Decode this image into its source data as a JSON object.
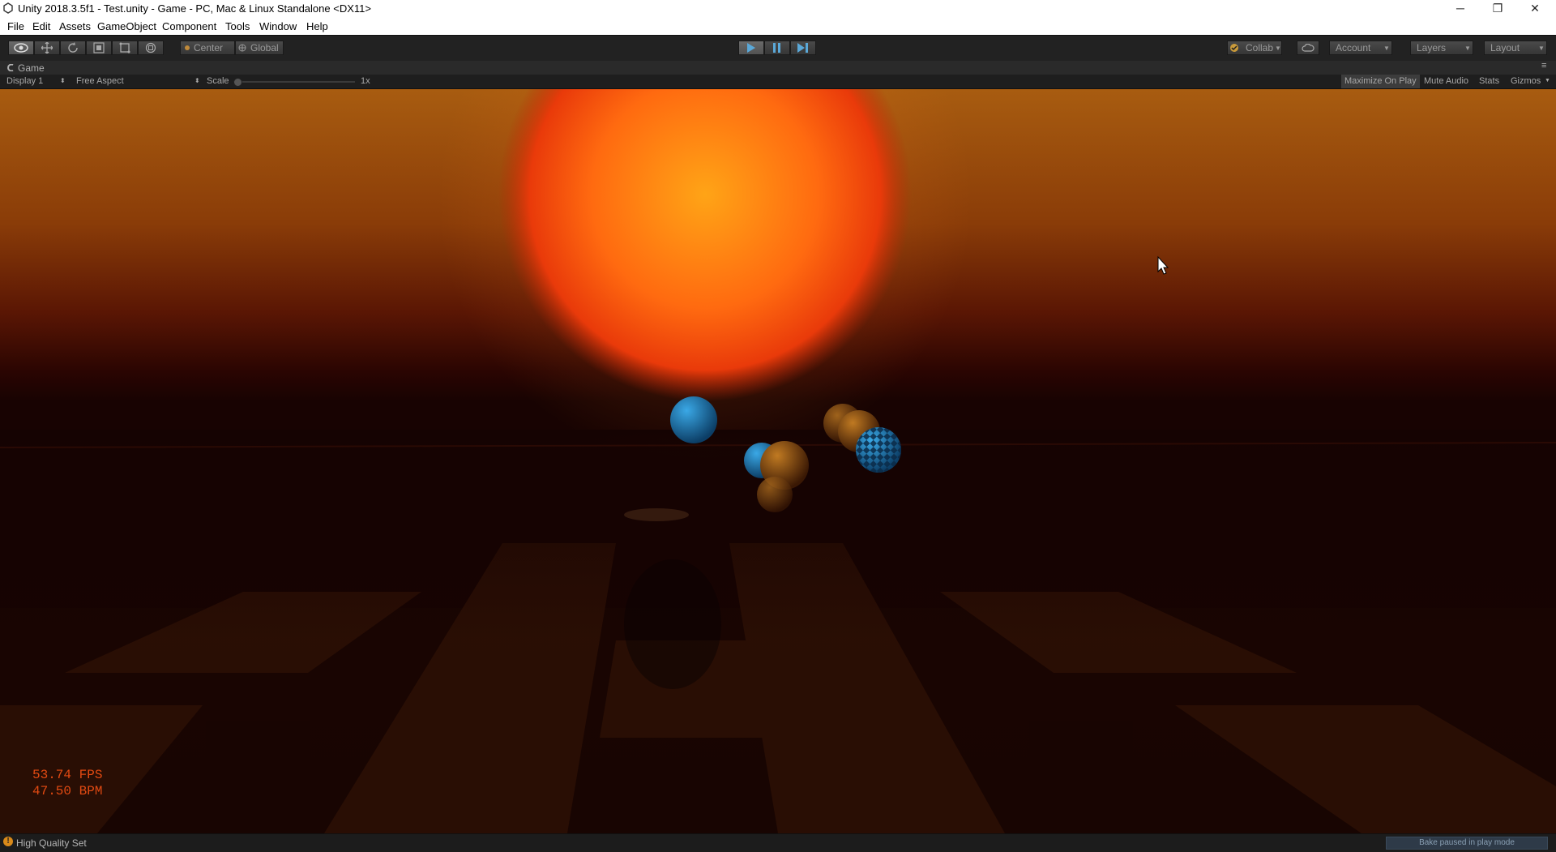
{
  "window": {
    "title": "Unity 2018.3.5f1 - Test.unity - Game - PC, Mac & Linux Standalone <DX11>",
    "minimize": "─",
    "restore": "❐",
    "close": "✕"
  },
  "menu": [
    "File",
    "Edit",
    "Assets",
    "GameObject",
    "Component",
    "Tools",
    "Window",
    "Help"
  ],
  "toolbar": {
    "pivot": "Center",
    "space": "Global",
    "collab": "Collab",
    "account": "Account",
    "layers": "Layers",
    "layout": "Layout"
  },
  "tab": {
    "label": "Game"
  },
  "gamebar": {
    "display": "Display 1",
    "aspect": "Free Aspect",
    "scale_label": "Scale",
    "scale_value": "1x",
    "maximize": "Maximize On Play",
    "mute": "Mute Audio",
    "stats": "Stats",
    "gizmos": "Gizmos"
  },
  "hud": {
    "fps": "53.74 FPS",
    "bpm": "47.50 BPM"
  },
  "status": {
    "message": "High Quality Set",
    "bake": "Bake paused in play mode"
  },
  "colors": {
    "accent_play": "#5aa8d8",
    "sun": "#ff9a14",
    "hud_text": "#e24a12"
  },
  "playmode": {
    "playing": true
  }
}
